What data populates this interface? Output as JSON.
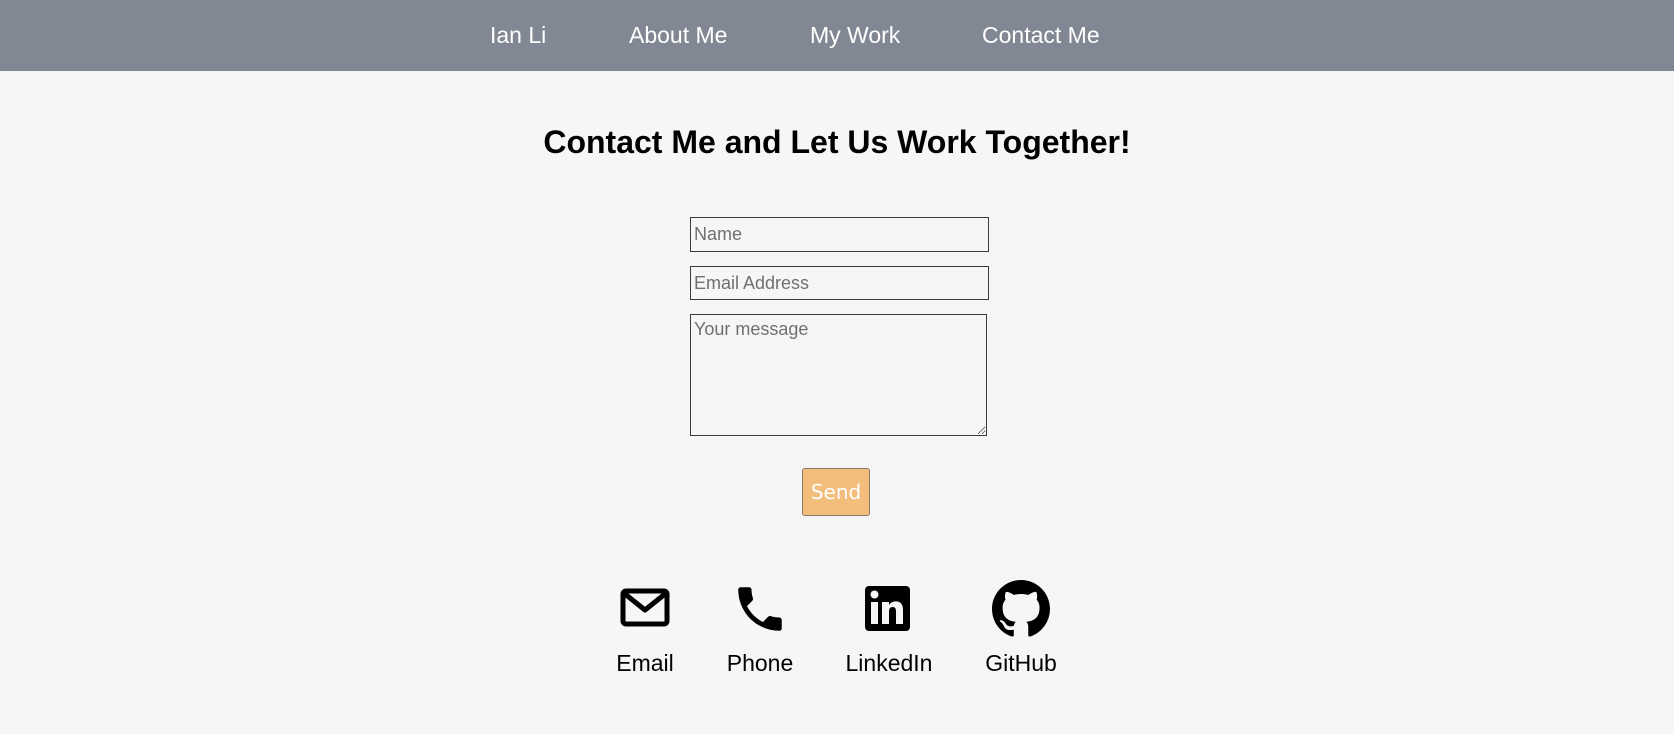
{
  "nav": {
    "brand": "Ian Li",
    "links": [
      "About Me",
      "My Work",
      "Contact Me"
    ]
  },
  "page": {
    "title": "Contact Me and Let Us Work Together!"
  },
  "form": {
    "name_placeholder": "Name",
    "email_placeholder": "Email Address",
    "message_placeholder": "Your message",
    "send_label": "Send"
  },
  "contacts": [
    {
      "label": "Email",
      "icon": "envelope-icon"
    },
    {
      "label": "Phone",
      "icon": "phone-icon"
    },
    {
      "label": "LinkedIn",
      "icon": "linkedin-icon"
    },
    {
      "label": "GitHub",
      "icon": "github-icon"
    }
  ],
  "colors": {
    "navbar_bg": "#828893",
    "page_bg": "#f6f6f6",
    "send_button": "#f3bd7b"
  }
}
